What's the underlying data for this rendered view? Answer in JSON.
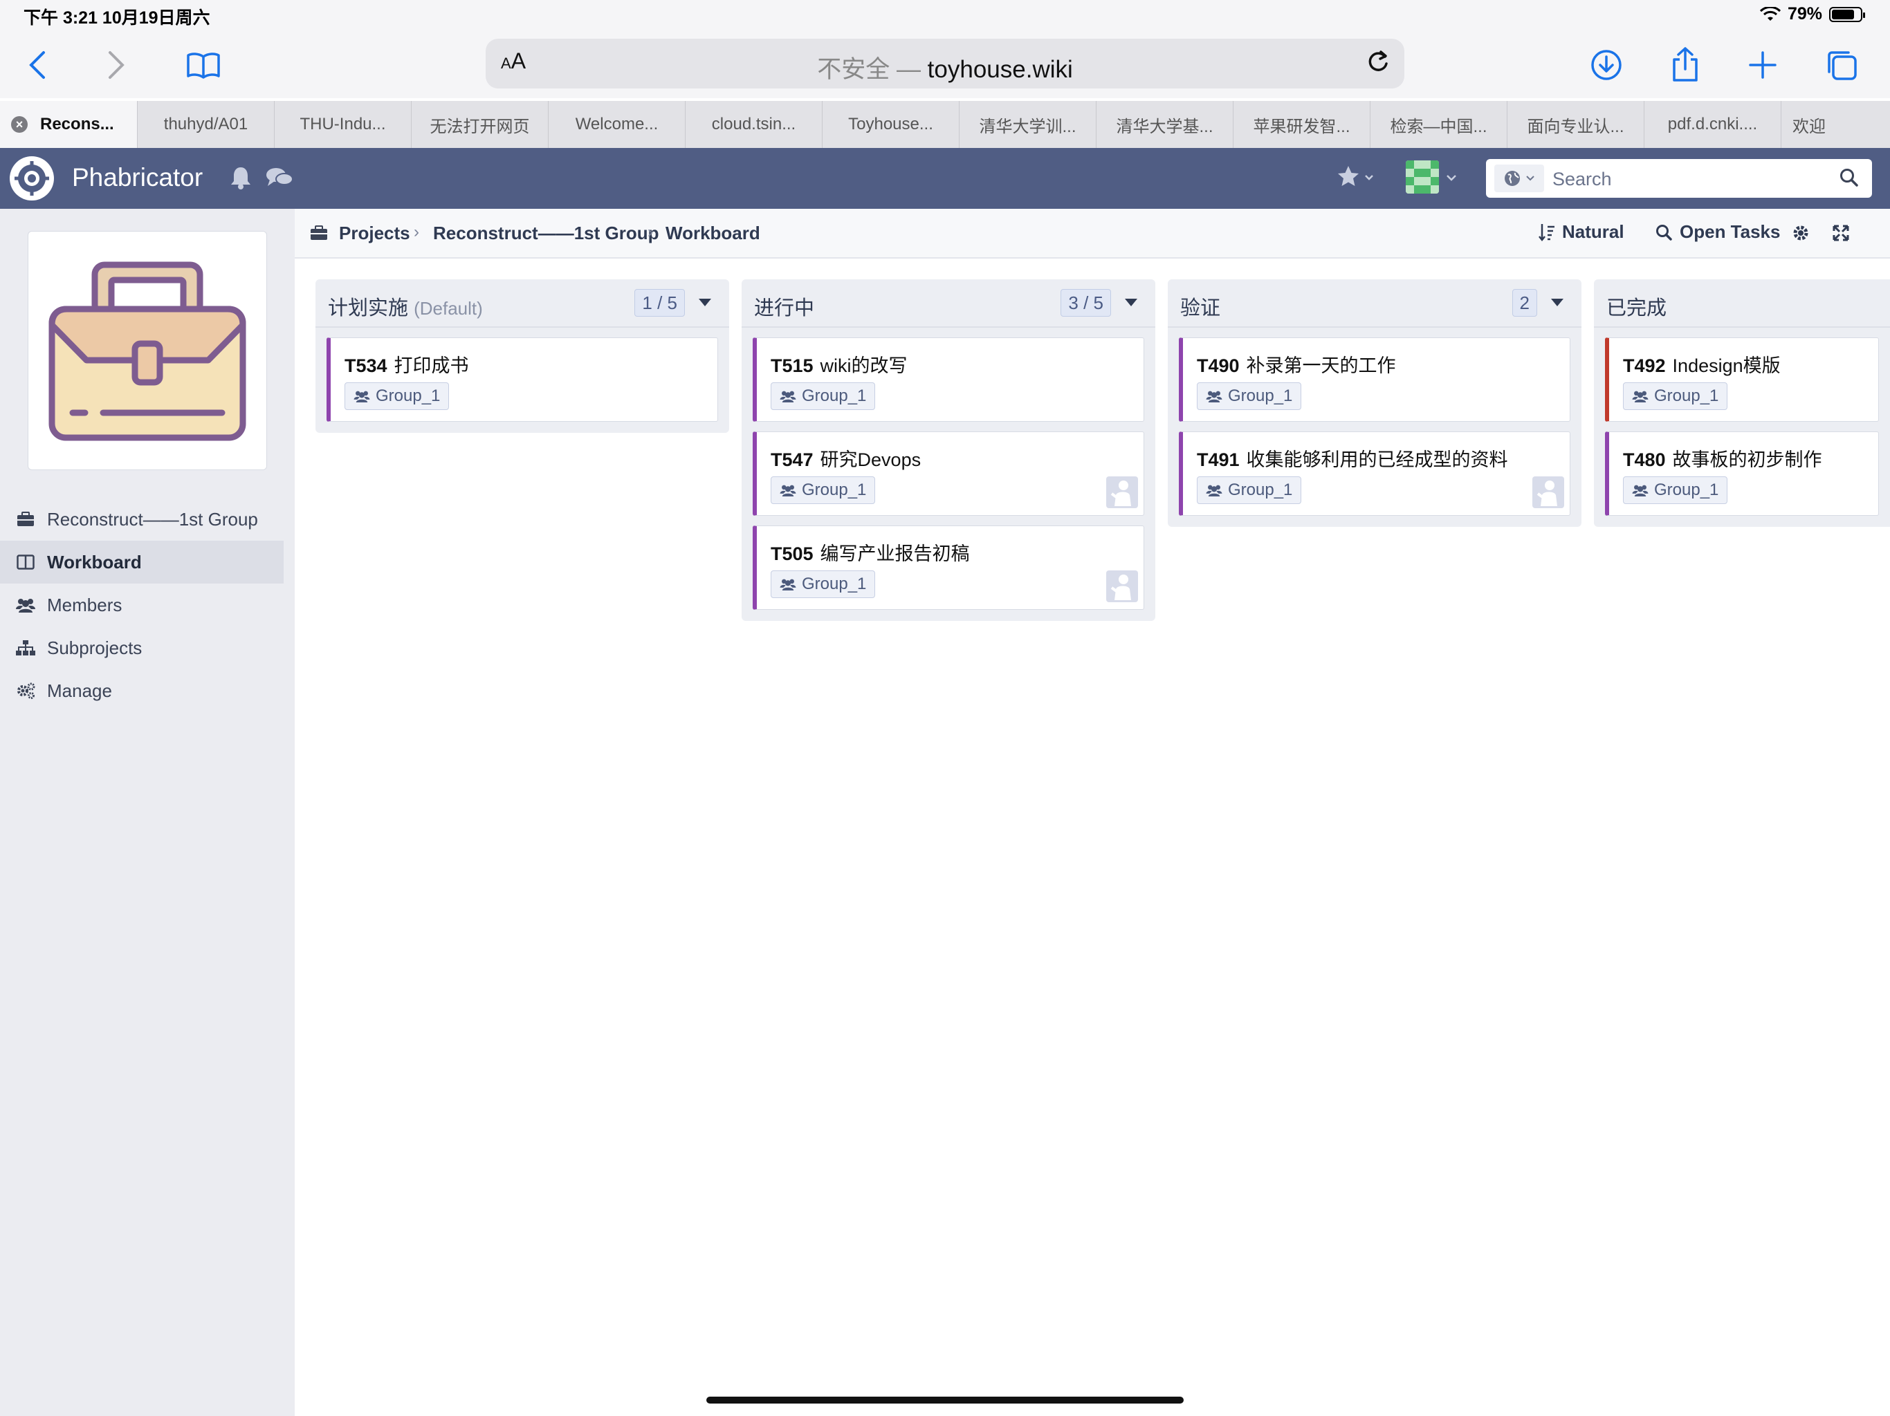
{
  "status_bar": {
    "time": "下午 3:21   10月19日周六",
    "battery": "79%",
    "battery_level": 0.79
  },
  "safari": {
    "text_size_button": "AA",
    "address_insecure": "不安全 — ",
    "address_host": "toyhouse.wiki"
  },
  "tabs": [
    {
      "label": "Recons...",
      "active": true
    },
    {
      "label": "thuhyd/A01"
    },
    {
      "label": "THU-Indu..."
    },
    {
      "label": "无法打开网页"
    },
    {
      "label": "Welcome..."
    },
    {
      "label": "cloud.tsin..."
    },
    {
      "label": "Toyhouse..."
    },
    {
      "label": "清华大学训..."
    },
    {
      "label": "清华大学基..."
    },
    {
      "label": "苹果研发智..."
    },
    {
      "label": "检索—中国..."
    },
    {
      "label": "面向专业认..."
    },
    {
      "label": "pdf.d.cnki...."
    },
    {
      "label": "欢迎"
    }
  ],
  "header": {
    "brand": "Phabricator",
    "search_placeholder": "Search",
    "color": "#505d84"
  },
  "crumbs": {
    "items": [
      "Projects",
      "Reconstruct——1st Group",
      "Workboard"
    ],
    "sort_label": "Natural",
    "filter_label": "Open Tasks"
  },
  "sidebar": {
    "items": [
      {
        "label": "Reconstruct——1st Group",
        "icon": "briefcase-icon"
      },
      {
        "label": "Workboard",
        "icon": "columns-icon",
        "selected": true
      },
      {
        "label": "Members",
        "icon": "users-icon"
      },
      {
        "label": "Subprojects",
        "icon": "sitemap-icon"
      },
      {
        "label": "Manage",
        "icon": "cogs-icon"
      }
    ]
  },
  "columns": [
    {
      "title": "计划实施",
      "subtitle": "(Default)",
      "count": "1 / 5",
      "cards": [
        {
          "id": "T534",
          "title": "打印成书",
          "tag": "Group_1",
          "owner": false
        }
      ]
    },
    {
      "title": "进行中",
      "subtitle": "",
      "count": "3 / 5",
      "cards": [
        {
          "id": "T515",
          "title": "wiki的改写",
          "tag": "Group_1",
          "owner": false
        },
        {
          "id": "T547",
          "title": "研究Devops",
          "tag": "Group_1",
          "owner": true
        },
        {
          "id": "T505",
          "title": "编写产业报告初稿",
          "tag": "Group_1",
          "owner": true
        }
      ]
    },
    {
      "title": "验证",
      "subtitle": "",
      "count": "2",
      "cards": [
        {
          "id": "T490",
          "title": "补录第一天的工作",
          "tag": "Group_1",
          "owner": false
        },
        {
          "id": "T491",
          "title": "收集能够利用的已经成型的资料",
          "tag": "Group_1",
          "owner": true
        }
      ]
    },
    {
      "title": "已完成",
      "subtitle": "",
      "count": "",
      "cards": [
        {
          "id": "T492",
          "title": "Indesign模版",
          "tag": "Group_1",
          "owner": false,
          "color": "#c0392b"
        },
        {
          "id": "T480",
          "title": "故事板的初步制作",
          "tag": "Group_1",
          "owner": false
        }
      ]
    }
  ]
}
